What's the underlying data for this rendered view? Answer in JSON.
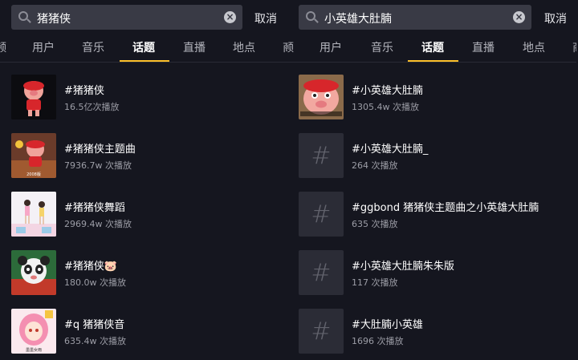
{
  "left": {
    "search": {
      "value": "猪猪侠"
    },
    "cancel_label": "取消",
    "tabs": [
      "频",
      "用户",
      "音乐",
      "话题",
      "直播",
      "地点",
      "商"
    ],
    "items": [
      {
        "title": "#猪猪侠",
        "count": "16.5亿次播放"
      },
      {
        "title": "#猪猪侠主题曲",
        "count": "7936.7w 次播放",
        "thumb_caption": "2008版"
      },
      {
        "title": "#猪猪侠舞蹈",
        "count": "2969.4w 次播放"
      },
      {
        "title": "#猪猪侠🐷",
        "count": "180.0w 次播放"
      },
      {
        "title": "#q 猪猪侠音",
        "count": "635.4w 次播放",
        "thumb_caption": "墨墨女雨"
      }
    ]
  },
  "right": {
    "search": {
      "value": "小英雄大肚腩"
    },
    "cancel_label": "取消",
    "tabs": [
      "频",
      "用户",
      "音乐",
      "话题",
      "直播",
      "地点",
      "商"
    ],
    "items": [
      {
        "title": "#小英雄大肚腩",
        "count": "1305.4w 次播放"
      },
      {
        "title": "#小英雄大肚腩_",
        "count": "264 次播放",
        "hash": "#"
      },
      {
        "title": "#ggbond 猪猪侠主题曲之小英雄大肚腩",
        "count": "635 次播放",
        "hash": "#"
      },
      {
        "title": "#小英雄大肚腩朱朱版",
        "count": "117 次播放",
        "hash": "#"
      },
      {
        "title": "#大肚腩小英雄",
        "count": "1696 次播放",
        "hash": "#"
      }
    ]
  },
  "colors": {
    "background": "#15161f",
    "search_bg": "#393a45",
    "accent_underline": "#fbbf2a",
    "muted_text": "#9c9da6"
  }
}
